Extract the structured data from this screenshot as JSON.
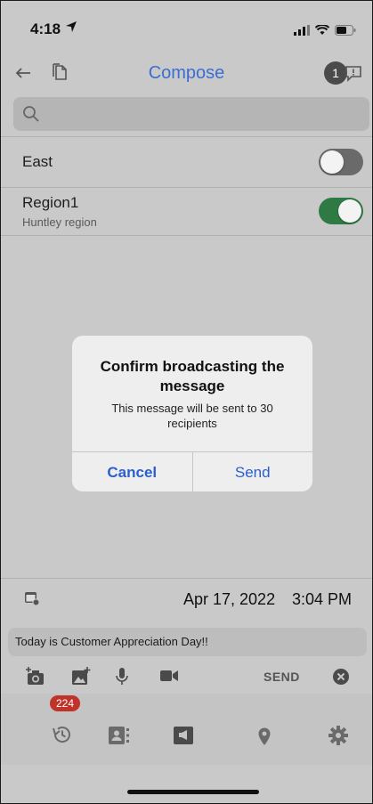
{
  "status_bar": {
    "time": "4:18"
  },
  "nav": {
    "title": "Compose",
    "notification_count": "1"
  },
  "search": {
    "placeholder": ""
  },
  "groups": [
    {
      "name": "East",
      "subtitle": "",
      "enabled": false
    },
    {
      "name": "Region1",
      "subtitle": "Huntley region",
      "enabled": true
    }
  ],
  "dialog": {
    "title": "Confirm broadcasting the message",
    "message": "This message will be sent to 30 recipients",
    "cancel_label": "Cancel",
    "send_label": "Send"
  },
  "schedule": {
    "date": "Apr 17, 2022",
    "time": "3:04 PM"
  },
  "compose": {
    "message_text": "Today is Customer Appreciation Day!!",
    "send_label": "SEND"
  },
  "tab_bar": {
    "history_badge": "224"
  },
  "colors": {
    "accent": "#3a6fd1",
    "toggle_on": "#2f7a44",
    "badge_red": "#c1322b"
  }
}
